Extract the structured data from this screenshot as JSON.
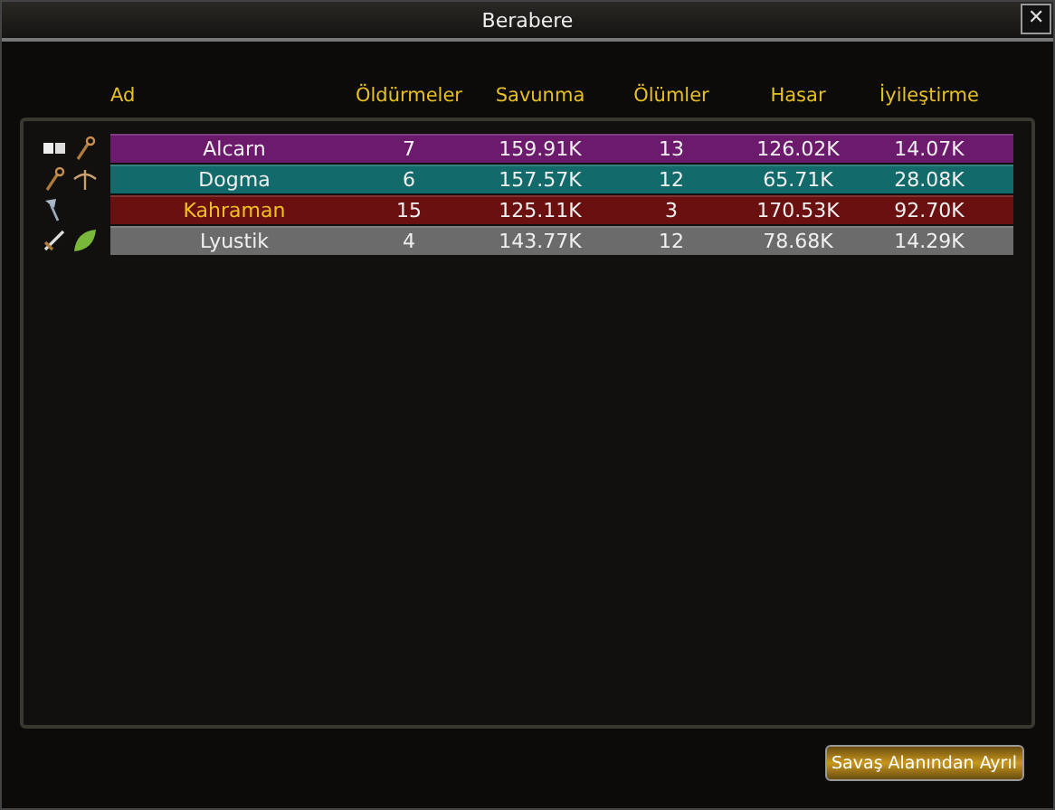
{
  "window": {
    "title": "Berabere",
    "close": "✕"
  },
  "table": {
    "columns": [
      "Ad",
      "Öldürmeler",
      "Savunma",
      "Ölümler",
      "Hasar",
      "İyileştirme"
    ],
    "rows": [
      {
        "icons": [
          {
            "kind": "book"
          },
          {
            "kind": "staff"
          }
        ],
        "color": "#6c1b6c",
        "highlighted": false,
        "cells": [
          "Alcarn",
          "7",
          "159.91K",
          "13",
          "126.02K",
          "14.07K"
        ]
      },
      {
        "icons": [
          {
            "kind": "staff"
          },
          {
            "kind": "bow"
          }
        ],
        "color": "#136a6a",
        "highlighted": false,
        "cells": [
          "Dogma",
          "6",
          "157.57K",
          "12",
          "65.71K",
          "28.08K"
        ]
      },
      {
        "icons": [
          {
            "kind": "axe"
          }
        ],
        "color": "#6a1010",
        "highlighted": true,
        "cells": [
          "Kahraman",
          "15",
          "125.11K",
          "3",
          "170.53K",
          "92.70K"
        ]
      },
      {
        "icons": [
          {
            "kind": "sword"
          },
          {
            "kind": "leaf"
          }
        ],
        "color": "#6b6b6b",
        "highlighted": false,
        "cells": [
          "Lyustik",
          "4",
          "143.77K",
          "12",
          "78.68K",
          "14.29K"
        ]
      }
    ]
  },
  "leave_button": "Savaş Alanından Ayrıl"
}
